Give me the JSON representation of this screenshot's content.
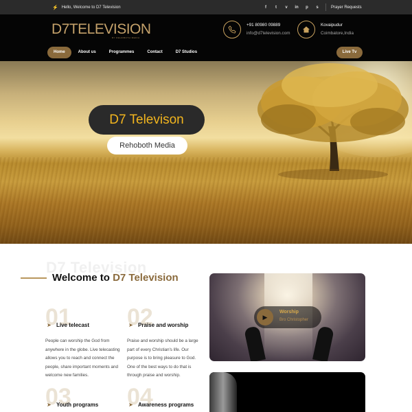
{
  "topbar": {
    "welcome_text": "Hello, Welcome to D7 Television",
    "social_icons": [
      "facebook-icon",
      "twitter-icon",
      "vimeo-icon",
      "linkedin-icon",
      "pinterest-icon",
      "skype-icon"
    ],
    "social_glyphs": [
      "f",
      "t",
      "v",
      "in",
      "p",
      "s"
    ],
    "prayer_link": "Prayer Requests"
  },
  "header": {
    "logo_text": "D7TELEVISION",
    "logo_subtext": "BY REHOBOTH MEDIA",
    "phone": "+91 80980 09889",
    "email": "info@d7television.com",
    "location_line1": "Kovaipudur",
    "location_line2": "Coimbatore,India",
    "nav": [
      "Home",
      "About us",
      "Programmes",
      "Contact",
      "D7 Studios"
    ],
    "live_button": "Live Tv"
  },
  "hero": {
    "title": "D7 Televison",
    "subtitle": "Rehoboth Media"
  },
  "welcome": {
    "ghost_text": "D7 Television",
    "heading_prefix": "Welcome to",
    "heading_brand": "D7 Television",
    "features": [
      {
        "num": "01",
        "title": "Live telecast",
        "body": "People can worship the God from anywhere in the globe.  Live telecasting allows you to reach and connect the people, share important moments and welcome new families."
      },
      {
        "num": "02",
        "title": "Praise and worship",
        "body": "Praise and worship should be a large part of every Christian's life. Our purpose is to bring pleasure to God. One of the best ways to do that is through praise and worship."
      },
      {
        "num": "03",
        "title": "Youth programs",
        "body": ""
      },
      {
        "num": "04",
        "title": "Awareness programs",
        "body": ""
      }
    ]
  },
  "video": {
    "title": "Worship",
    "author": "Bro Christopher"
  },
  "colors": {
    "accent": "#8a6a3c",
    "gold_text": "#f2b51e",
    "topbar_bg": "#2b2b2b",
    "header_bg": "#050505"
  }
}
